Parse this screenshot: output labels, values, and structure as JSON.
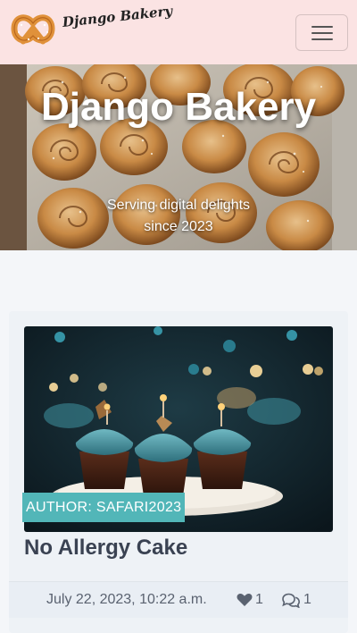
{
  "navbar": {
    "brand_name": "Django Bakery",
    "logo_icon": "pretzel-icon",
    "toggler_icon": "hamburger-menu-icon"
  },
  "hero": {
    "title": "Django Bakery",
    "subtitle": "Serving digital delights since 2023"
  },
  "post": {
    "author_badge": "AUTHOR: SAFARI2023",
    "title": "No Allergy Cake",
    "date": "July 22, 2023, 10:22 a.m.",
    "likes": "1",
    "comments": "1",
    "like_icon": "heart-icon",
    "comment_icon": "comments-icon"
  },
  "colors": {
    "navbar_bg": "#fbe3e3",
    "badge_bg": "#52b6b8",
    "card_bg": "#eef2f6",
    "page_bg": "#f4f6f9",
    "text": "#3a4252"
  }
}
